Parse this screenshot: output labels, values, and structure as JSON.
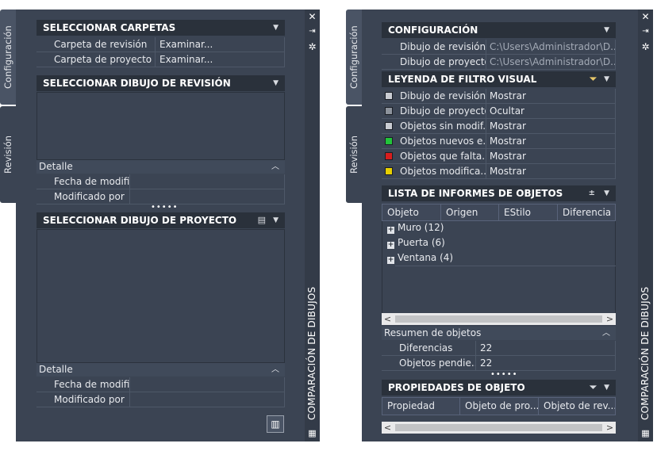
{
  "strip_title": "COMPARACIÓN DE DIBUJOS",
  "tabs": {
    "config": "Configuración",
    "revision": "Revisión"
  },
  "left": {
    "select_folders": {
      "title": "SELECCIONAR CARPETAS",
      "rows": [
        {
          "label": "Carpeta de revisión",
          "value": "Examinar..."
        },
        {
          "label": "Carpeta de proyecto",
          "value": "Examinar..."
        }
      ]
    },
    "select_revision": {
      "title": "SELECCIONAR DIBUJO DE REVISIÓN",
      "detail_title": "Detalle",
      "rows": [
        {
          "label": "Fecha de modifi..."
        },
        {
          "label": "Modificado por"
        }
      ]
    },
    "select_project": {
      "title": "SELECCIONAR DIBUJO DE PROYECTO",
      "detail_title": "Detalle",
      "rows": [
        {
          "label": "Fecha de modifi..."
        },
        {
          "label": "Modificado por"
        }
      ]
    },
    "grip": "•••••"
  },
  "right": {
    "config": {
      "title": "CONFIGURACIÓN",
      "rows": [
        {
          "label": "Dibujo de revisión",
          "value": "C:\\Users\\Administrador\\D..."
        },
        {
          "label": "Dibujo de proyecto",
          "value": "C:\\Users\\Administrador\\D..."
        }
      ]
    },
    "legend": {
      "title": "LEYENDA DE FILTRO VISUAL",
      "rows": [
        {
          "label": "Dibujo de revisión",
          "value": "Mostrar",
          "color": "#c9ccd2"
        },
        {
          "label": "Dibujo de proyecto",
          "value": "Ocultar",
          "color": "#8d939c"
        },
        {
          "label": "Objetos sin modif...",
          "value": "Mostrar",
          "color": "#c9ccd2"
        },
        {
          "label": "Objetos nuevos e...",
          "value": "Mostrar",
          "color": "#22c43a"
        },
        {
          "label": "Objetos que falta...",
          "value": "Mostrar",
          "color": "#d81e1e"
        },
        {
          "label": "Objetos modifica...",
          "value": "Mostrar",
          "color": "#e8d000"
        }
      ]
    },
    "report": {
      "title": "LISTA DE INFORMES DE OBJETOS",
      "columns": [
        "Objeto",
        "Origen",
        "EStilo",
        "Diferencia"
      ],
      "items": [
        "Muro (12)",
        "Puerta (6)",
        "Ventana (4)"
      ],
      "summary_title": "Resumen de objetos",
      "summary": [
        {
          "label": "Diferencias",
          "value": "22"
        },
        {
          "label": "Objetos pendie...",
          "value": "22"
        }
      ]
    },
    "props": {
      "title": "PROPIEDADES DE OBJETO",
      "columns": [
        "Propiedad",
        "Objeto de pro...",
        "Objeto de rev..."
      ]
    },
    "grip": "•••••"
  },
  "icons": {
    "close": "close-icon",
    "pin": "auto-hide-icon",
    "settings": "properties-icon",
    "caret": "chevron-down-icon"
  }
}
